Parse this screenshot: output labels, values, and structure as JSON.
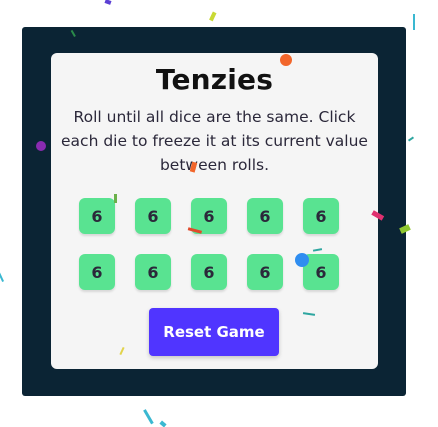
{
  "game": {
    "title": "Tenzies",
    "instructions": "Roll until all dice are the same. Click each die to freeze it at its current value between rolls.",
    "dice": [
      {
        "value": "6",
        "held": true
      },
      {
        "value": "6",
        "held": true
      },
      {
        "value": "6",
        "held": true
      },
      {
        "value": "6",
        "held": true
      },
      {
        "value": "6",
        "held": true
      },
      {
        "value": "6",
        "held": true
      },
      {
        "value": "6",
        "held": true
      },
      {
        "value": "6",
        "held": true
      },
      {
        "value": "6",
        "held": true
      },
      {
        "value": "6",
        "held": true
      }
    ],
    "reset_label": "Reset Game"
  },
  "colors": {
    "frame": "#0b2434",
    "card": "#f5f5f5",
    "die_held": "#59e391",
    "button": "#5035ff",
    "text": "#2b283a"
  },
  "decorations": {
    "confetti_state": "celebration-active"
  }
}
